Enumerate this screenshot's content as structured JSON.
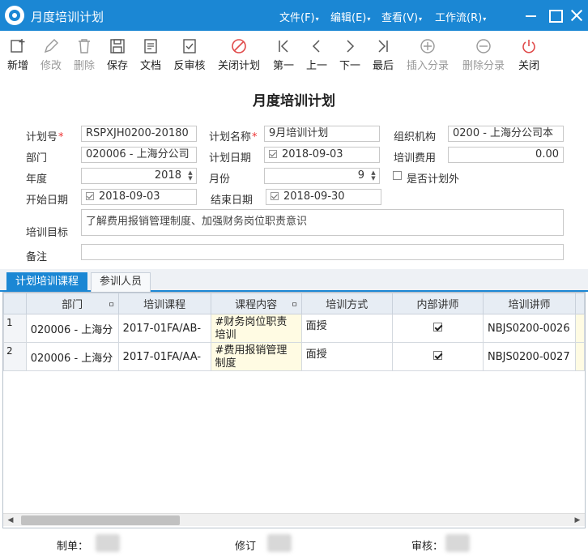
{
  "window": {
    "title": "月度培训计划",
    "menus": [
      {
        "label": "文件(F)"
      },
      {
        "label": "编辑(E)"
      },
      {
        "label": "查看(V)"
      },
      {
        "label": "工作流(R)"
      }
    ]
  },
  "toolbar": {
    "new": "新增",
    "edit": "修改",
    "delete": "删除",
    "save": "保存",
    "document": "文档",
    "unaudit": "反审核",
    "close_plan": "关闭计划",
    "first": "第一",
    "prev": "上一",
    "next": "下一",
    "last": "最后",
    "insert_entry": "插入分录",
    "delete_entry": "删除分录",
    "close": "关闭"
  },
  "form": {
    "title": "月度培训计划",
    "plan_no": {
      "label": "计划号",
      "value": "RSPXJH0200-20180"
    },
    "plan_name": {
      "label": "计划名称",
      "value": "9月培训计划"
    },
    "org": {
      "label": "组织机构",
      "value": "0200 - 上海分公司本"
    },
    "dept": {
      "label": "部门",
      "value": "020006 - 上海分公司"
    },
    "plan_date": {
      "label": "计划日期",
      "value": "2018-09-03"
    },
    "cost": {
      "label": "培训费用",
      "value": "0.00"
    },
    "year": {
      "label": "年度",
      "value": "2018"
    },
    "month": {
      "label": "月份",
      "value": "9"
    },
    "extra_plan": {
      "label": "是否计划外"
    },
    "start_date": {
      "label": "开始日期",
      "value": "2018-09-03"
    },
    "end_date": {
      "label": "结束日期",
      "value": "2018-09-30"
    },
    "goal": {
      "label": "培训目标",
      "value": "了解费用报销管理制度、加强财务岗位职责意识"
    },
    "note": {
      "label": "备注",
      "value": ""
    }
  },
  "tabs": {
    "courses": "计划培训课程",
    "attendees": "参训人员"
  },
  "grid": {
    "columns": [
      "部门",
      "培训课程",
      "课程内容",
      "培训方式",
      "内部讲师",
      "培训讲师"
    ],
    "rows": [
      {
        "no": "1",
        "dept": "020006 - 上海分",
        "course": "2017-01FA/AB-",
        "content": "#财务岗位职责培训",
        "method": "面授",
        "internal": true,
        "lecturer": "NBJS0200-0026"
      },
      {
        "no": "2",
        "dept": "020006 - 上海分",
        "course": "2017-01FA/AA-",
        "content": "#费用报销管理制度",
        "method": "面授",
        "internal": true,
        "lecturer": "NBJS0200-0027"
      }
    ]
  },
  "footer": {
    "maker": "制单：",
    "revise": "修订",
    "auditor": "审核："
  }
}
